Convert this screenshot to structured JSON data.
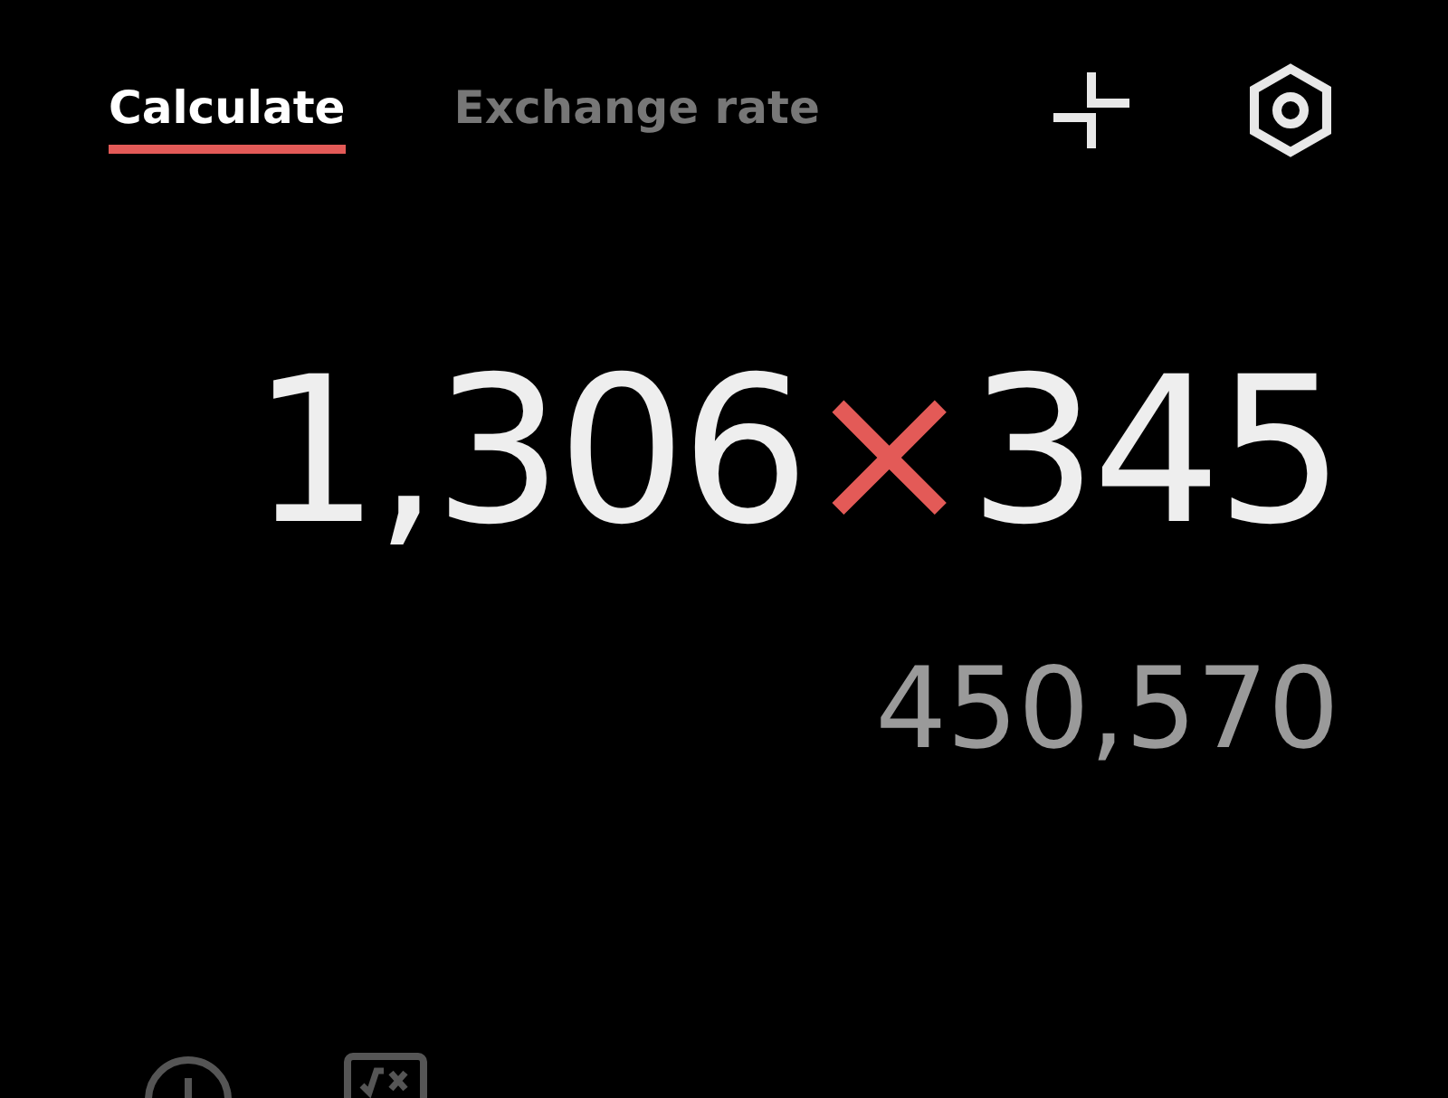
{
  "tabs": [
    {
      "label": "Calculate",
      "selected": true
    },
    {
      "label": "Exchange rate",
      "selected": false
    }
  ],
  "expression": [
    {
      "kind": "number",
      "text": "1,306"
    },
    {
      "kind": "operator",
      "text": "×"
    },
    {
      "kind": "number",
      "text": "345"
    }
  ],
  "result": "450,570"
}
